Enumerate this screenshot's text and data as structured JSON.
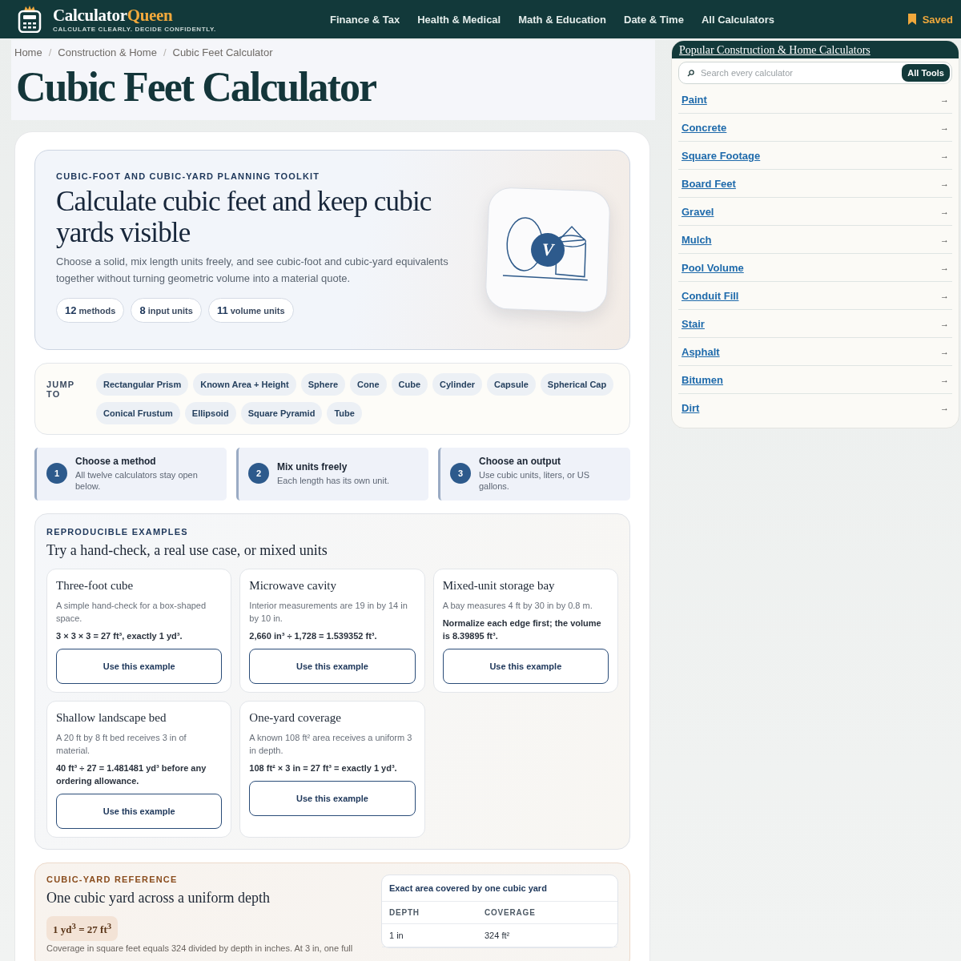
{
  "header": {
    "brand_main": "Calculator",
    "brand_accent": "Queen",
    "tagline": "CALCULATE CLEARLY. DECIDE CONFIDENTLY.",
    "nav": [
      "Finance & Tax",
      "Health & Medical",
      "Math & Education",
      "Date & Time",
      "All Calculators"
    ],
    "saved": "Saved"
  },
  "breadcrumb": [
    "Home",
    "Construction & Home",
    "Cubic Feet Calculator"
  ],
  "breadcrumb_separator": "/",
  "title": "Cubic Feet Calculator",
  "hero": {
    "eyebrow": "CUBIC-FOOT AND CUBIC-YARD PLANNING TOOLKIT",
    "heading": "Calculate cubic feet and keep cubic yards visible",
    "text": "Choose a solid, mix length units freely, and see cubic-foot and cubic-yard equivalents together without turning geometric volume into a material quote.",
    "stats": [
      {
        "value": "12",
        "label": "methods"
      },
      {
        "value": "8",
        "label": "input units"
      },
      {
        "value": "11",
        "label": "volume units"
      }
    ],
    "badge_letter": "V"
  },
  "jump": {
    "label": "JUMP TO",
    "links": [
      "Rectangular Prism",
      "Known Area + Height",
      "Sphere",
      "Cone",
      "Cube",
      "Cylinder",
      "Capsule",
      "Spherical Cap",
      "Conical Frustum",
      "Ellipsoid",
      "Square Pyramid",
      "Tube"
    ]
  },
  "steps": [
    {
      "number": "1",
      "title": "Choose a method",
      "text": "All twelve calculators stay open below."
    },
    {
      "number": "2",
      "title": "Mix units freely",
      "text": "Each length has its own unit."
    },
    {
      "number": "3",
      "title": "Choose an output",
      "text": "Use cubic units, liters, or US gallons."
    }
  ],
  "examples": {
    "eyebrow": "REPRODUCIBLE EXAMPLES",
    "heading": "Try a hand-check, a real use case, or mixed units",
    "cards": [
      {
        "title": "Three-foot cube",
        "text": "A simple hand-check for a box-shaped space.",
        "result": "3 × 3 × 3 = 27 ft³, exactly 1 yd³.",
        "button": "Use this example"
      },
      {
        "title": "Microwave cavity",
        "text": "Interior measurements are 19 in by 14 in by 10 in.",
        "result": "2,660 in³ ÷ 1,728 = 1.539352 ft³.",
        "button": "Use this example"
      },
      {
        "title": "Mixed-unit storage bay",
        "text": "A bay measures 4 ft by 30 in by 0.8 m.",
        "result": "Normalize each edge first; the volume is 8.39895 ft³.",
        "button": "Use this example"
      },
      {
        "title": "Shallow landscape bed",
        "text": "A 20 ft by 8 ft bed receives 3 in of material.",
        "result": "40 ft³ ÷ 27 = 1.481481 yd³ before any ordering allowance.",
        "button": "Use this example"
      },
      {
        "title": "One-yard coverage",
        "text": "A known 108 ft² area receives a uniform 3 in depth.",
        "result": "108 ft² × 3 in = 27 ft³ = exactly 1 yd³.",
        "button": "Use this example"
      }
    ]
  },
  "reference": {
    "eyebrow": "CUBIC-YARD REFERENCE",
    "heading": "One cubic yard across a uniform depth",
    "formula": "1 yd$^{3}$ = 27 ft$^{3}$",
    "text": "Coverage in square feet equals 324 divided by depth in inches. At 3 in, one full",
    "table": {
      "caption": "Exact area covered by one cubic yard",
      "columns": [
        "DEPTH",
        "COVERAGE"
      ],
      "rows": [
        [
          "1 in",
          "324 ft²"
        ]
      ]
    }
  },
  "sidebar": {
    "title": "Popular Construction & Home Calculators",
    "search_placeholder": "Search every calculator",
    "search_button": "All Tools",
    "items": [
      "Paint",
      "Concrete",
      "Square Footage",
      "Board Feet",
      "Gravel",
      "Mulch",
      "Pool Volume",
      "Conduit Fill",
      "Stair",
      "Asphalt",
      "Bitumen",
      "Dirt"
    ],
    "arrow": "→"
  }
}
